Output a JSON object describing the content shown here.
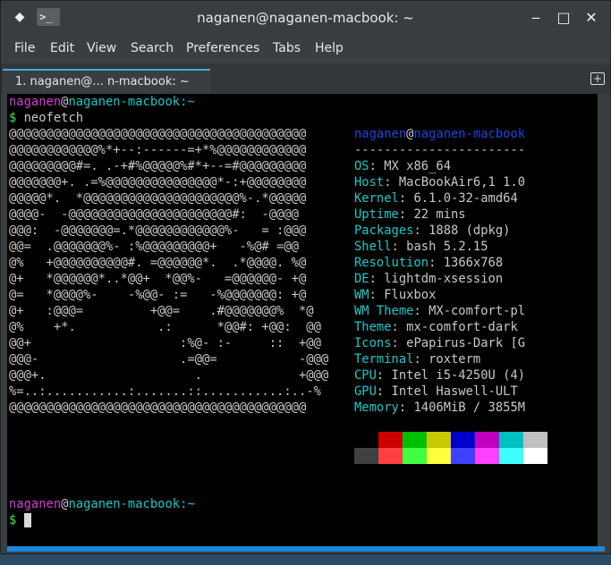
{
  "titlebar": {
    "title": "naganen@naganen-macbook: ~",
    "app_icon_text": ">_",
    "minimize": "‒",
    "maximize": "□",
    "close": "✕",
    "pin": "◆"
  },
  "menubar": {
    "items": [
      "File",
      "Edit",
      "View",
      "Search",
      "Preferences",
      "Tabs",
      "Help"
    ]
  },
  "tabs": [
    {
      "label": "1. naganen@...  n-macbook: ~"
    }
  ],
  "terminal": {
    "prompt_user": "naganen",
    "prompt_at": "@",
    "prompt_host": "naganen-macbook",
    "prompt_path": ":~",
    "prompt_symbol": "$",
    "command": " neofetch",
    "ascii_art": [
      "@@@@@@@@@@@@@@@@@@@@@@@@@@@@@@@@@@@@@@@@",
      "@@@@@@@@@@@@%*+--:------=+*%@@@@@@@@@@@@",
      "@@@@@@@@@#=. .-+#%@@@@@%#*+--=#@@@@@@@@@",
      "@@@@@@@+. .=%@@@@@@@@@@@@@@@*-:+@@@@@@@@",
      "@@@@@*.  *@@@@@@@@@@@@@@@@@@@@@%-.*@@@@@",
      "@@@@-  -@@@@@@@@@@@@@@@@@@@@@@#:  -@@@@",
      "@@@:  -@@@@@@@=.*@@@@@@@@@@@@%-   = :@@@",
      "@@=  .@@@@@@@%- :%@@@@@@@@@+   -%@# =@@",
      "@%   +@@@@@@@@@@#. =@@@@@@*.  .*@@@@. %@",
      "@+   *@@@@@@*..*@@+  *@@%-   =@@@@@@- +@",
      "@=   *@@@@%-    -%@@- :=   -%@@@@@@@: +@",
      "@+   :@@@=         +@@=    .#@@@@@@@%  *@",
      "@%    +*.           .:      *@@#: +@@:  @@",
      "@@+                    :%@- :-     ::  +@@",
      "@@@-                   .=@@=           -@@@",
      "@@@+.                    .             +@@@",
      "%=..:...........:.......::...........:..-%",
      "@@@@@@@@@@@@@@@@@@@@@@@@@@@@@@@@@@@@@@@@"
    ],
    "info_header_user": "naganen",
    "info_header_at": "@",
    "info_header_host": "naganen-macbook",
    "info_separator": "-----------------------",
    "info": [
      {
        "key": "OS",
        "value": "MX x86_64"
      },
      {
        "key": "Host",
        "value": "MacBookAir6,1 1.0"
      },
      {
        "key": "Kernel",
        "value": "6.1.0-32-amd64"
      },
      {
        "key": "Uptime",
        "value": "22 mins"
      },
      {
        "key": "Packages",
        "value": "1888 (dpkg)"
      },
      {
        "key": "Shell",
        "value": "bash 5.2.15"
      },
      {
        "key": "Resolution",
        "value": "1366x768"
      },
      {
        "key": "DE",
        "value": "lightdm-xsession"
      },
      {
        "key": "WM",
        "value": "Fluxbox"
      },
      {
        "key": "WM Theme",
        "value": "MX-comfort-pl"
      },
      {
        "key": "Theme",
        "value": "mx-comfort-dark"
      },
      {
        "key": "Icons",
        "value": "ePapirus-Dark [G"
      },
      {
        "key": "Terminal",
        "value": "roxterm"
      },
      {
        "key": "CPU",
        "value": "Intel i5-4250U (4)"
      },
      {
        "key": "GPU",
        "value": "Intel Haswell-ULT"
      },
      {
        "key": "Memory",
        "value": "1406MiB / 3855M"
      }
    ],
    "palette_top": [
      "#000000",
      "#cc0000",
      "#00c000",
      "#c8c800",
      "#0000cc",
      "#c000c0",
      "#00c0c0",
      "#c0c0c0"
    ],
    "palette_bottom": [
      "#404040",
      "#ff4040",
      "#40ff40",
      "#ffff40",
      "#4040ff",
      "#ff40ff",
      "#40ffff",
      "#ffffff"
    ]
  },
  "colors": {
    "accent": "#1e87d8",
    "prompt_user": "#d23ed2",
    "prompt_host": "#18c8c8",
    "prompt_symbol": "#4ce04c",
    "info_key": "#1cc9c9"
  }
}
